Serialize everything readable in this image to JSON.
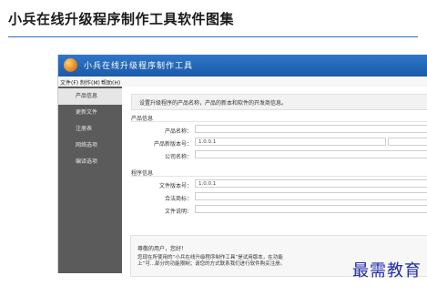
{
  "page": {
    "title": "小兵在线升级程序制作工具软件图集"
  },
  "window": {
    "title": "小兵在线升级程序制作工具",
    "menu": [
      "文件(F)",
      "制作(M)",
      "帮助(H)"
    ]
  },
  "sidebar": {
    "items": [
      {
        "label": "产品信息",
        "active": true
      },
      {
        "label": "更新文件",
        "active": false
      },
      {
        "label": "注册表",
        "active": false
      },
      {
        "label": "网络选项",
        "active": false
      },
      {
        "label": "编译选项",
        "active": false
      }
    ]
  },
  "content": {
    "intro": "设置升级程序的产品名称，产品的新本和软件的开发商信息。",
    "product_section": "产品信息",
    "product_fields": [
      {
        "label": "产品名称：",
        "value": ""
      },
      {
        "label": "产品新版本号：",
        "value": "1.0.0.1"
      },
      {
        "label": "公司名称：",
        "value": ""
      }
    ],
    "program_section": "程序信息",
    "program_fields": [
      {
        "label": "文件版本号：",
        "value": "1.0.0.1"
      },
      {
        "label": "合法商标：",
        "value": ""
      },
      {
        "label": "文件说明：",
        "value": ""
      }
    ],
    "notice_greet": "尊敬的用户，您好！",
    "notice_body": "您现在所使用的“小兵在线升级程序制作工具”是试用版本，在功能上“可...部分的功能限制；请您的方式联系我们进行软件购买注册。"
  },
  "watermark": "最需教育"
}
